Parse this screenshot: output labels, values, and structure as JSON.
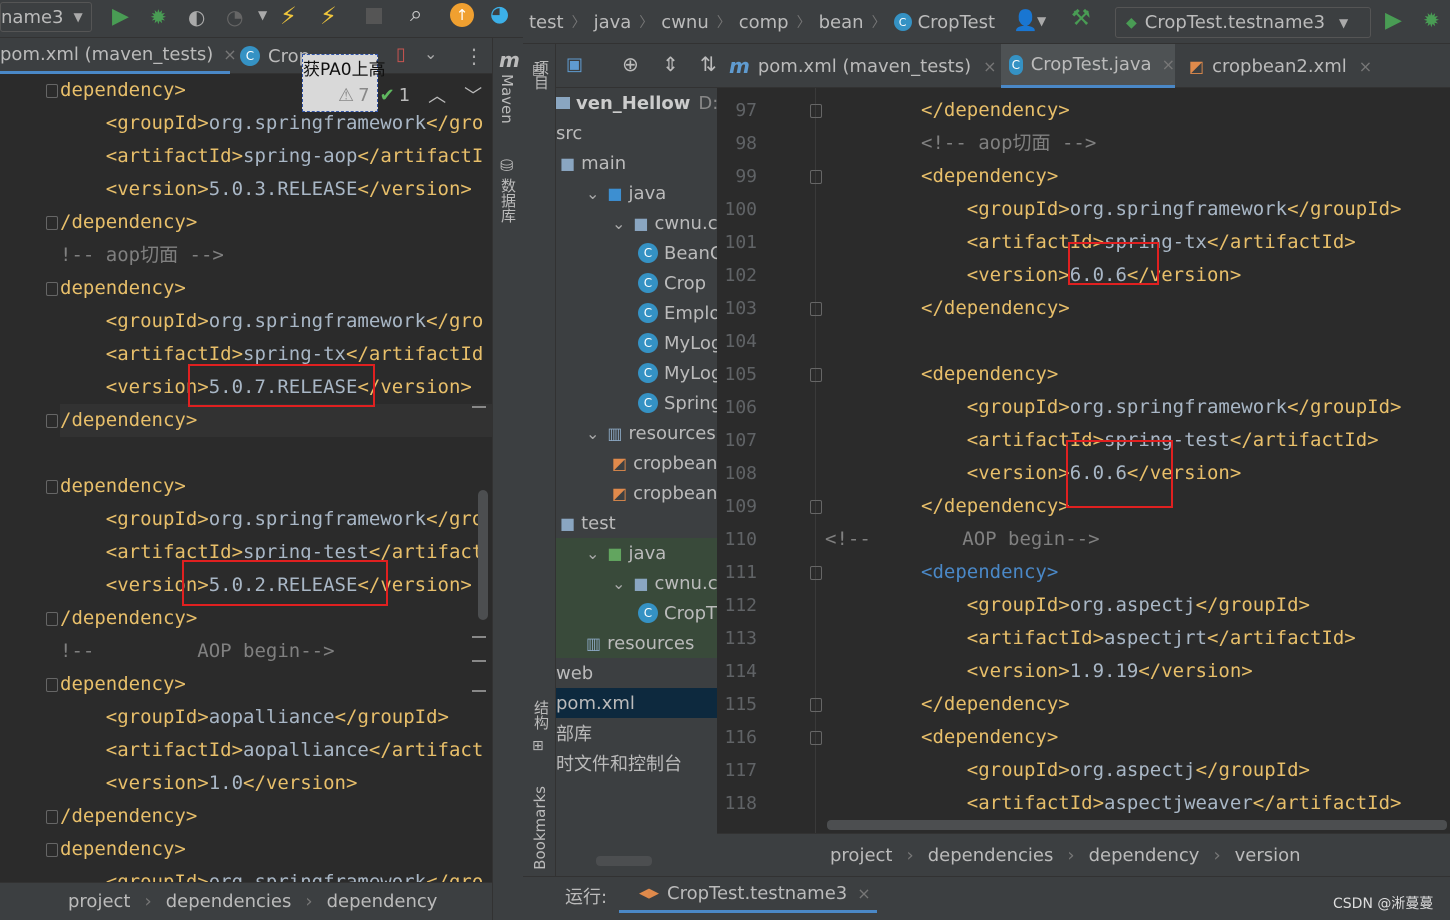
{
  "left_window": {
    "run_config": "name3",
    "tabs": [
      {
        "label": "pom.xml (maven_tests)"
      },
      {
        "label": "Crop"
      }
    ],
    "popup_text": "获PA0上高",
    "inspection": {
      "warnings": "7",
      "ok": "1"
    },
    "right_strip": {
      "maven": "Maven",
      "database": "数据库"
    },
    "breadcrumb": [
      "project",
      "dependencies",
      "dependency"
    ],
    "code": [
      {
        "text": "dependency>",
        "kind": "tag"
      },
      {
        "pre": "    ",
        "open": "<groupId>",
        "val": "org.springframework",
        "close": "</gro",
        "kind": "kv"
      },
      {
        "pre": "    ",
        "open": "<artifactId>",
        "val": "spring-aop",
        "close": "</artifactI",
        "kind": "kv"
      },
      {
        "pre": "    ",
        "open": "<version>",
        "val": "5.0.3.RELEASE",
        "close": "</version>",
        "kind": "kv"
      },
      {
        "text": "/dependency>",
        "kind": "tag"
      },
      {
        "text": "!-- aop切面 -->",
        "kind": "comment"
      },
      {
        "text": "dependency>",
        "kind": "tag"
      },
      {
        "pre": "    ",
        "open": "<groupId>",
        "val": "org.springframework",
        "close": "</gro",
        "kind": "kv"
      },
      {
        "pre": "    ",
        "open": "<artifactId>",
        "val": "spring-tx",
        "close": "</artifactId",
        "kind": "kv"
      },
      {
        "pre": "    ",
        "open": "<version>",
        "val": "5.0.7.RELEASE",
        "close": "</version>",
        "kind": "kv"
      },
      {
        "text": "/dependency>",
        "kind": "tag"
      },
      {
        "text": "",
        "kind": "blank"
      },
      {
        "text": "dependency>",
        "kind": "tag"
      },
      {
        "pre": "    ",
        "open": "<groupId>",
        "val": "org.springframework",
        "close": "</gro",
        "kind": "kv"
      },
      {
        "pre": "    ",
        "open": "<artifactId>",
        "val": "spring-test",
        "close": "</artifact",
        "kind": "kv"
      },
      {
        "pre": "    ",
        "open": "<version>",
        "val": "5.0.2.RELEASE",
        "close": "</version>",
        "kind": "kv"
      },
      {
        "text": "/dependency>",
        "kind": "tag"
      },
      {
        "text": "!--         AOP begin-->",
        "kind": "comment"
      },
      {
        "text": "dependency>",
        "kind": "tag"
      },
      {
        "pre": "    ",
        "open": "<groupId>",
        "val": "aopalliance",
        "close": "</groupId>",
        "kind": "kv"
      },
      {
        "pre": "    ",
        "open": "<artifactId>",
        "val": "aopalliance",
        "close": "</artifact",
        "kind": "kv"
      },
      {
        "pre": "    ",
        "open": "<version>",
        "val": "1.0",
        "close": "</version>",
        "kind": "kv"
      },
      {
        "text": "/dependency>",
        "kind": "tag"
      },
      {
        "text": "dependency>",
        "kind": "tag"
      },
      {
        "pre": "    ",
        "open": "<groupId>",
        "val": "org.springframework",
        "close": "</gro",
        "kind": "kv"
      }
    ]
  },
  "right_window": {
    "breadcrumb_top": [
      "test",
      "java",
      "cwnu",
      "comp",
      "bean",
      "CropTest"
    ],
    "run_config": "CropTest.testname3",
    "side_labels": {
      "project": "项目",
      "structure": "结构",
      "bookmarks": "Bookmarks"
    },
    "project_header": {
      "name": "ven_Hellow",
      "path": "D:\\jav"
    },
    "tree": [
      {
        "label": "src",
        "indent": 0,
        "icon": "none",
        "arrow": ""
      },
      {
        "label": "main",
        "indent": 0,
        "icon": "folder",
        "arrow": ""
      },
      {
        "label": "java",
        "indent": 1,
        "icon": "folder-blue",
        "arrow": "v"
      },
      {
        "label": "cwnu.com",
        "indent": 2,
        "icon": "package",
        "arrow": "v"
      },
      {
        "label": "BeanC",
        "indent": 3,
        "icon": "class",
        "arrow": ""
      },
      {
        "label": "Crop",
        "indent": 3,
        "icon": "class",
        "arrow": ""
      },
      {
        "label": "Emplo",
        "indent": 3,
        "icon": "class",
        "arrow": ""
      },
      {
        "label": "MyLog",
        "indent": 3,
        "icon": "class",
        "arrow": ""
      },
      {
        "label": "MyLog",
        "indent": 3,
        "icon": "class",
        "arrow": ""
      },
      {
        "label": "Spring",
        "indent": 3,
        "icon": "class",
        "arrow": ""
      },
      {
        "label": "resources",
        "indent": 1,
        "icon": "resources",
        "arrow": "v"
      },
      {
        "label": "cropbean",
        "indent": 2,
        "icon": "xml",
        "arrow": ""
      },
      {
        "label": "cropbean",
        "indent": 2,
        "icon": "xml",
        "arrow": ""
      },
      {
        "label": "test",
        "indent": 0,
        "icon": "folder",
        "arrow": ""
      },
      {
        "label": "java",
        "indent": 1,
        "icon": "folder-green",
        "arrow": "v"
      },
      {
        "label": "cwnu.com",
        "indent": 2,
        "icon": "package",
        "arrow": "v"
      },
      {
        "label": "CropT",
        "indent": 3,
        "icon": "class",
        "arrow": ""
      },
      {
        "label": "resources",
        "indent": 1,
        "icon": "resources",
        "arrow": ""
      },
      {
        "label": "web",
        "indent": 0,
        "icon": "none",
        "arrow": ""
      },
      {
        "label": "pom.xml",
        "indent": 0,
        "icon": "none",
        "arrow": ""
      },
      {
        "label": "部库",
        "indent": 0,
        "icon": "none",
        "arrow": ""
      },
      {
        "label": "时文件和控制台",
        "indent": 0,
        "icon": "none",
        "arrow": ""
      }
    ],
    "tabs": [
      {
        "label": "pom.xml (maven_tests)",
        "icon": "maven"
      },
      {
        "label": "CropTest.java",
        "icon": "class"
      },
      {
        "label": "cropbean2.xml",
        "icon": "xml"
      }
    ],
    "lines": [
      {
        "n": "97",
        "pre": "",
        "text": "</dependency>",
        "kind": "tag"
      },
      {
        "n": "98",
        "pre": "",
        "text": "<!-- aop切面 -->",
        "kind": "comment"
      },
      {
        "n": "99",
        "pre": "",
        "text": "<dependency>",
        "kind": "tag"
      },
      {
        "n": "100",
        "pre": "    ",
        "open": "<groupId>",
        "val": "org.springframework",
        "close": "</groupId>",
        "kind": "kv"
      },
      {
        "n": "101",
        "pre": "    ",
        "open": "<artifactId>",
        "val": "spring-tx",
        "close": "</artifactId>",
        "kind": "kv"
      },
      {
        "n": "102",
        "pre": "    ",
        "open": "<version>",
        "val": "6.0.6",
        "close": "</version>",
        "kind": "kv"
      },
      {
        "n": "103",
        "pre": "",
        "text": "</dependency>",
        "kind": "tag"
      },
      {
        "n": "104",
        "pre": "",
        "text": "",
        "kind": "blank"
      },
      {
        "n": "105",
        "pre": "",
        "text": "<dependency>",
        "kind": "tag"
      },
      {
        "n": "106",
        "pre": "    ",
        "open": "<groupId>",
        "val": "org.springframework",
        "close": "</groupId>",
        "kind": "kv"
      },
      {
        "n": "107",
        "pre": "    ",
        "open": "<artifactId>",
        "val": "spring-test",
        "close": "</artifactId>",
        "kind": "kv"
      },
      {
        "n": "108",
        "pre": "    ",
        "open": "<version>",
        "val": "6.0.6",
        "close": "</version>",
        "kind": "kv"
      },
      {
        "n": "109",
        "pre": "",
        "text": "</dependency>",
        "kind": "tag"
      },
      {
        "n": "110",
        "pre": "",
        "text": "<!--        AOP begin-->",
        "kind": "comment-out"
      },
      {
        "n": "111",
        "pre": "",
        "text": "<dependency>",
        "kind": "tag-hl"
      },
      {
        "n": "112",
        "pre": "    ",
        "open": "<groupId>",
        "val": "org.aspectj",
        "close": "</groupId>",
        "kind": "kv"
      },
      {
        "n": "113",
        "pre": "    ",
        "open": "<artifactId>",
        "val": "aspectjrt",
        "close": "</artifactId>",
        "kind": "kv"
      },
      {
        "n": "114",
        "pre": "    ",
        "open": "<version>",
        "val": "1.9.19",
        "close": "</version>",
        "kind": "kv"
      },
      {
        "n": "115",
        "pre": "",
        "text": "</dependency>",
        "kind": "tag"
      },
      {
        "n": "116",
        "pre": "",
        "text": "<dependency>",
        "kind": "tag"
      },
      {
        "n": "117",
        "pre": "    ",
        "open": "<groupId>",
        "val": "org.aspectj",
        "close": "</groupId>",
        "kind": "kv"
      },
      {
        "n": "118",
        "pre": "    ",
        "open": "<artifactId>",
        "val": "aspectjweaver",
        "close": "</artifactId>",
        "kind": "kv"
      }
    ],
    "breadcrumb_bottom": [
      "project",
      "dependencies",
      "dependency",
      "version"
    ],
    "run_label": "运行:",
    "run_tab": "CropTest.testname3",
    "watermark": "CSDN @淅蔓蔓"
  },
  "colors": {
    "tag": "#e8bf6a",
    "text": "#a9b7c6",
    "comment": "#808080",
    "highlight_tag": "#4a88c7",
    "annotation_box": "#e02020",
    "run_green": "#499c54",
    "lightning": "#f0c63c"
  }
}
